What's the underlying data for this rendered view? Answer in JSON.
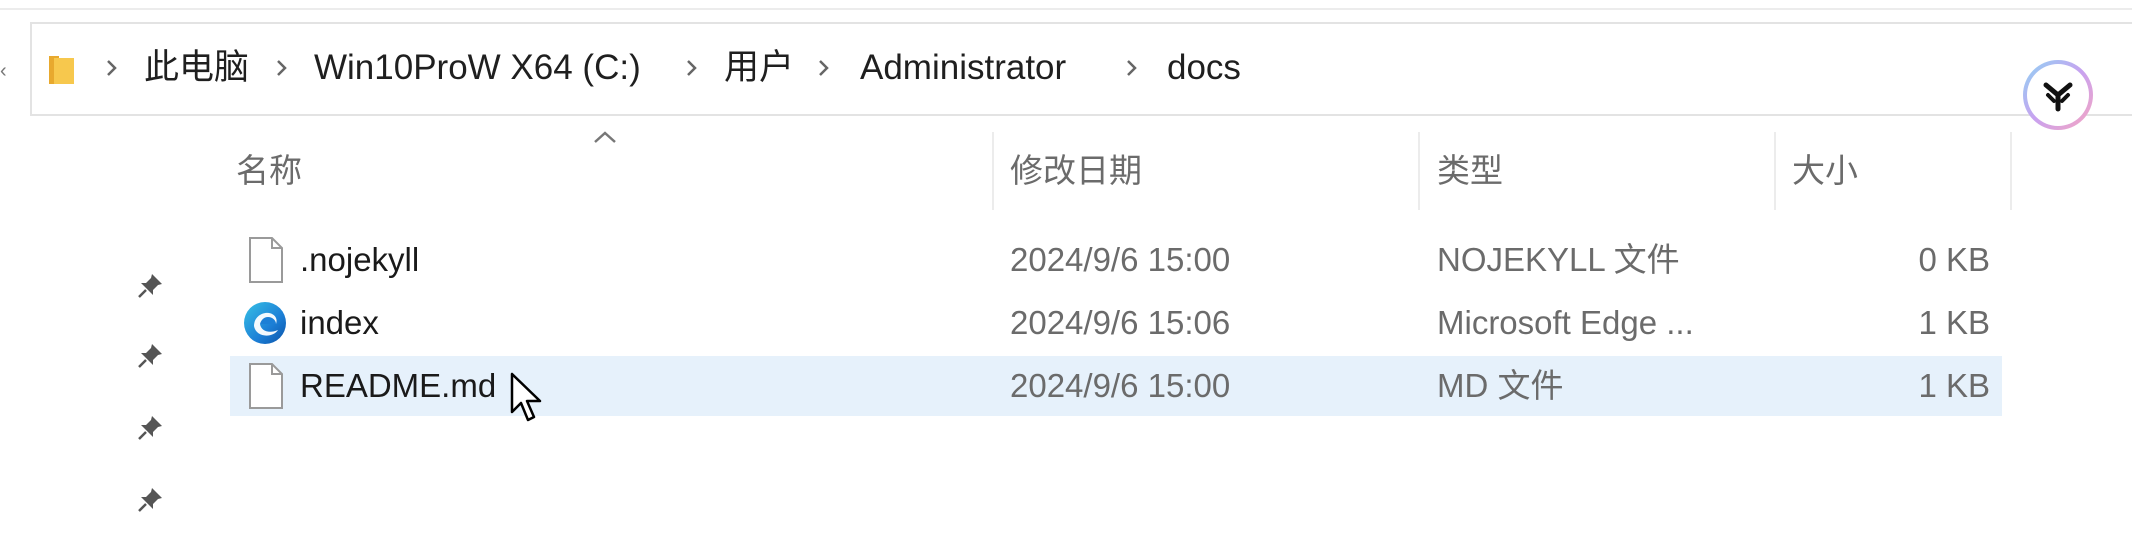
{
  "address_bar": {
    "breadcrumbs": [
      "此电脑",
      "Win10ProW X64 (C:)",
      "用户",
      "Administrator",
      "docs"
    ]
  },
  "columns": {
    "name": "名称",
    "modified": "修改日期",
    "type": "类型",
    "size": "大小"
  },
  "files": [
    {
      "name": ".nojekyll",
      "modified": "2024/9/6 15:00",
      "type": "NOJEKYLL 文件",
      "size": "0 KB",
      "icon": "blank-file-icon",
      "selected": false
    },
    {
      "name": "index",
      "modified": "2024/9/6 15:06",
      "type": "Microsoft Edge ...",
      "size": "1 KB",
      "icon": "edge-icon",
      "selected": false
    },
    {
      "name": "README.md",
      "modified": "2024/9/6 15:00",
      "type": "MD 文件",
      "size": "1 KB",
      "icon": "blank-file-icon",
      "selected": true
    }
  ],
  "colors": {
    "selection": "#e6f1fb",
    "folder": "#f2c14e",
    "header_text": "#6b6b6b"
  }
}
